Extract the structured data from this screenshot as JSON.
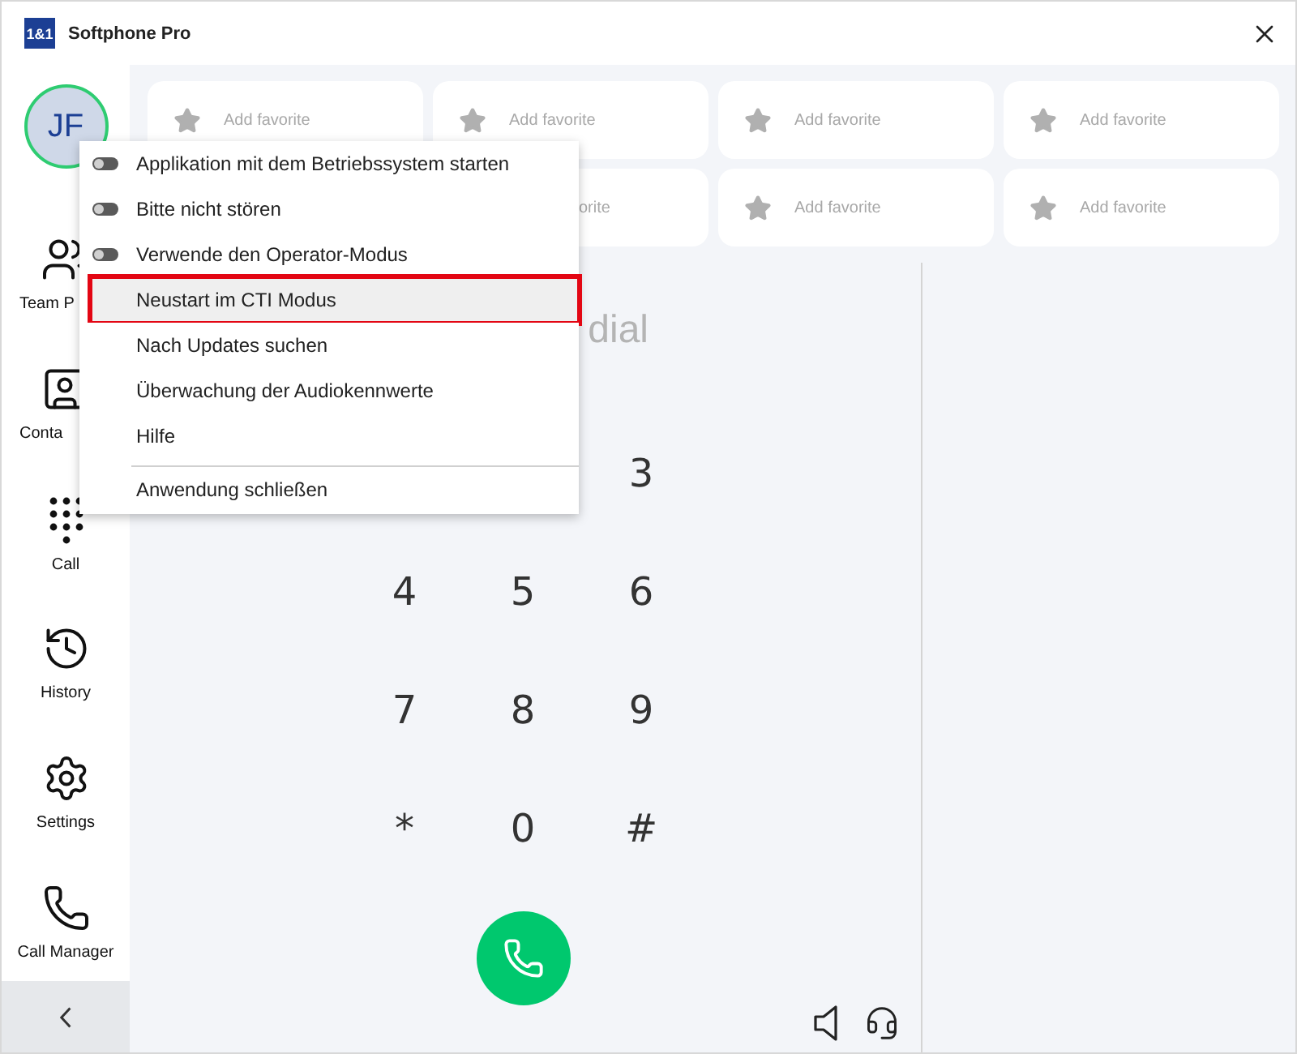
{
  "window": {
    "logo": "1&1",
    "title": "Softphone Pro"
  },
  "avatar": {
    "initials": "JF"
  },
  "sidebar": {
    "items": [
      {
        "label": "Team P",
        "kind": "cut"
      },
      {
        "label": "Conta",
        "kind": "cut"
      },
      {
        "label": "Call",
        "kind": "full"
      },
      {
        "label": "History",
        "kind": "full"
      },
      {
        "label": "Settings",
        "kind": "full"
      },
      {
        "label": "Call Manager",
        "kind": "full"
      }
    ]
  },
  "favorites": [
    {
      "kind": "full",
      "label": "Add favorite"
    },
    {
      "kind": "full",
      "label": "Add favorite"
    },
    {
      "kind": "full",
      "label": "Add favorite"
    },
    {
      "kind": "full",
      "label": "Add favorite"
    },
    {
      "kind": "covered"
    },
    {
      "kind": "cut",
      "label": "orite"
    },
    {
      "kind": "full",
      "label": "Add favorite"
    },
    {
      "kind": "full",
      "label": "Add favorite"
    }
  ],
  "dialer": {
    "display": "dial",
    "keys": [
      {
        "kind": "covered"
      },
      {
        "kind": "covered"
      },
      {
        "kind": "key",
        "label": "3"
      },
      {
        "kind": "key",
        "label": "4"
      },
      {
        "kind": "key",
        "label": "5"
      },
      {
        "kind": "key",
        "label": "6"
      },
      {
        "kind": "key",
        "label": "7"
      },
      {
        "kind": "key",
        "label": "8"
      },
      {
        "kind": "key",
        "label": "9"
      },
      {
        "kind": "key",
        "label": "*"
      },
      {
        "kind": "key",
        "label": "0"
      },
      {
        "kind": "key",
        "label": "#"
      }
    ]
  },
  "menu": {
    "items": [
      {
        "kind": "toggle",
        "label": "Applikation mit dem Betriebssystem starten",
        "on": false,
        "selected": false
      },
      {
        "kind": "toggle",
        "label": "Bitte nicht stören",
        "on": false,
        "selected": false
      },
      {
        "kind": "toggle",
        "label": "Verwende den Operator-Modus",
        "on": false,
        "selected": false
      },
      {
        "kind": "plain",
        "label": "Neustart im CTI Modus",
        "selected": true
      },
      {
        "kind": "plain",
        "label": "Nach Updates suchen",
        "selected": false
      },
      {
        "kind": "plain",
        "label": "Überwachung der Audiokennwerte",
        "selected": false
      },
      {
        "kind": "plain",
        "label": "Hilfe",
        "selected": false
      },
      {
        "kind": "divider"
      },
      {
        "kind": "plain",
        "label": "Anwendung schließen",
        "selected": false
      }
    ]
  }
}
